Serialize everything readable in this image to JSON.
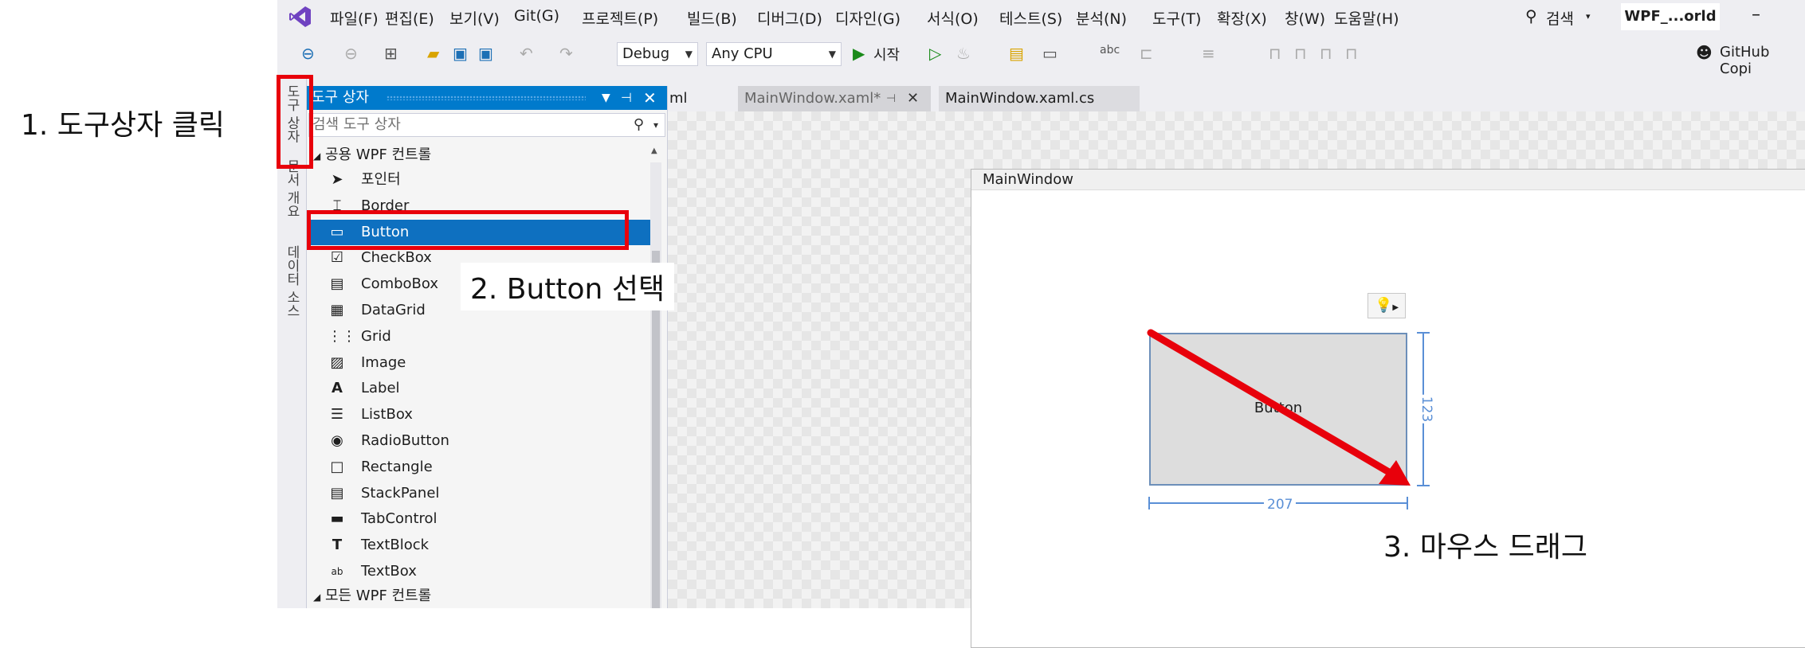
{
  "annotations": {
    "step1": "1. 도구상자 클릭",
    "step2": "2. Button 선택",
    "step3": "3. 마우스 드래그"
  },
  "menu": {
    "items": [
      "파일(F)",
      "편집(E)",
      "보기(V)",
      "Git(G)",
      "프로젝트(P)",
      "빌드(B)",
      "디버그(D)",
      "디자인(G)",
      "서식(O)",
      "테스트(S)",
      "분석(N)",
      "도구(T)",
      "확장(X)",
      "창(W)",
      "도움말(H)"
    ],
    "search_label": "검색",
    "solution_name": "WPF_...orld"
  },
  "toolbar": {
    "config": "Debug",
    "platform": "Any CPU",
    "start_label": "시작",
    "copilot": "GitHub Copi"
  },
  "side_tabs": [
    "도구 상자",
    "문서 개요",
    "데이터 소스"
  ],
  "toolbox": {
    "title": "도구 상자",
    "search_placeholder": "검색 도구 상자",
    "group_common": "공용 WPF 컨트롤",
    "group_all": "모든 WPF 컨트롤",
    "items": [
      {
        "label": "포인터",
        "icon": "pointer-icon"
      },
      {
        "label": "Border",
        "icon": "border-icon"
      },
      {
        "label": "Button",
        "icon": "button-icon",
        "selected": true
      },
      {
        "label": "CheckBox",
        "icon": "checkbox-icon"
      },
      {
        "label": "ComboBox",
        "icon": "combobox-icon"
      },
      {
        "label": "DataGrid",
        "icon": "datagrid-icon"
      },
      {
        "label": "Grid",
        "icon": "grid-icon"
      },
      {
        "label": "Image",
        "icon": "image-icon"
      },
      {
        "label": "Label",
        "icon": "label-icon"
      },
      {
        "label": "ListBox",
        "icon": "listbox-icon"
      },
      {
        "label": "RadioButton",
        "icon": "radiobutton-icon"
      },
      {
        "label": "Rectangle",
        "icon": "rectangle-icon"
      },
      {
        "label": "StackPanel",
        "icon": "stackpanel-icon"
      },
      {
        "label": "TabControl",
        "icon": "tabcontrol-icon"
      },
      {
        "label": "TextBlock",
        "icon": "textblock-icon"
      },
      {
        "label": "TextBox",
        "icon": "textbox-icon"
      }
    ]
  },
  "doc_tabs": [
    "ml",
    "MainWindow.xaml*",
    "MainWindow.xaml.cs"
  ],
  "designer": {
    "window_title": "MainWindow",
    "button_content": "Button",
    "width_value": "207",
    "height_value": "123"
  },
  "colors": {
    "accent": "#007acc",
    "selection": "#0e70c0",
    "annotation_red": "#e8000b"
  }
}
